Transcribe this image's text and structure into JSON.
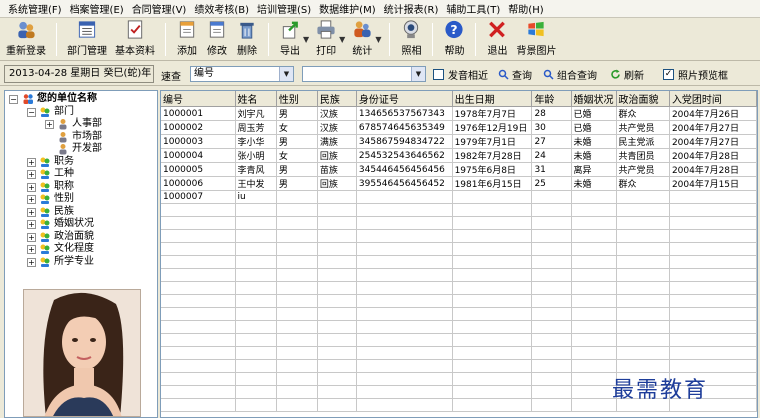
{
  "menu": [
    "系统管理(F)",
    "档案管理(E)",
    "合同管理(V)",
    "绩效考核(B)",
    "培训管理(S)",
    "数据维护(M)",
    "统计报表(R)",
    "辅助工具(T)",
    "帮助(H)"
  ],
  "toolbar": {
    "relogin": "重新登录",
    "dept_manage": "部门管理",
    "basic_info": "基本资料",
    "add": "添加",
    "edit": "修改",
    "delete": "删除",
    "export": "导出",
    "print": "打印",
    "stats": "统计",
    "photo": "照相",
    "help": "帮助",
    "exit": "退出",
    "bg_image": "背景图片"
  },
  "searchbar": {
    "date": "2013-04-28 星期日 癸巳(蛇)年",
    "quick_search_label": "速查",
    "field_value": "编号",
    "keyword_value": "",
    "fuzzy_label": "发音相近",
    "query_label": "查询",
    "combo_query_label": "组合查询",
    "refresh_label": "刷新",
    "photo_preview_label": "照片预览框",
    "photo_preview_checked": "✓"
  },
  "tree": {
    "root": "您的单位名称",
    "dept": "部门",
    "dept_children": [
      "人事部",
      "市场部",
      "开发部"
    ],
    "categories": [
      "职务",
      "工种",
      "职称",
      "性别",
      "民族",
      "婚姻状况",
      "政治面貌",
      "文化程度",
      "所学专业"
    ]
  },
  "grid": {
    "columns": [
      "编号",
      "姓名",
      "性别",
      "民族",
      "身份证号",
      "出生日期",
      "年龄",
      "婚姻状况",
      "政治面貌",
      "入党团时间"
    ],
    "rows": [
      [
        "1000001",
        "刘宇凡",
        "男",
        "汉族",
        "134656537567343",
        "1978年7月7日",
        "28",
        "已婚",
        "群众",
        "2004年7月26日"
      ],
      [
        "1000002",
        "周玉芳",
        "女",
        "汉族",
        "678574645635349",
        "1976年12月19日",
        "30",
        "已婚",
        "共产党员",
        "2004年7月27日"
      ],
      [
        "1000003",
        "李小华",
        "男",
        "满族",
        "345867594834722",
        "1979年7月1日",
        "27",
        "未婚",
        "民主党派",
        "2004年7月27日"
      ],
      [
        "1000004",
        "张小明",
        "女",
        "回族",
        "254532543646562",
        "1982年7月28日",
        "24",
        "未婚",
        "共青团员",
        "2004年7月28日"
      ],
      [
        "1000005",
        "李青风",
        "男",
        "苗族",
        "345446456456456",
        "1975年6月8日",
        "31",
        "离异",
        "共产党员",
        "2004年7月28日"
      ],
      [
        "1000006",
        "王中发",
        "男",
        "回族",
        "395546456456452",
        "1981年6月15日",
        "25",
        "未婚",
        "群众",
        "2004年7月15日"
      ],
      [
        "1000007",
        "iu",
        "",
        "",
        "",
        "",
        "",
        "",
        "",
        ""
      ]
    ]
  },
  "watermark": "最需教育",
  "colors": {
    "accent": "#1e3d9a",
    "toolbar_bg": "#ece9d8",
    "grid_border": "#7f9db9"
  }
}
